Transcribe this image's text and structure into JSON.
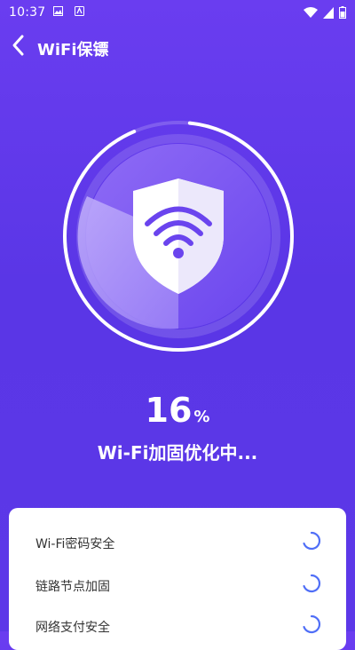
{
  "status_bar": {
    "time": "10:37"
  },
  "header": {
    "title": "WiFi保镖",
    "back_icon": "chevron-left-icon"
  },
  "scan": {
    "percent": "16",
    "percent_unit": "%",
    "progress": 0.16,
    "status": "Wi-Fi加固优化中..."
  },
  "checks": [
    {
      "label": "Wi-Fi密码安全",
      "state": "loading"
    },
    {
      "label": "链路节点加固",
      "state": "loading"
    },
    {
      "label": "网络支付安全",
      "state": "loading"
    }
  ],
  "colors": {
    "background": "#6a3df0",
    "accent": "#4f6ef7",
    "card": "#ffffff"
  }
}
